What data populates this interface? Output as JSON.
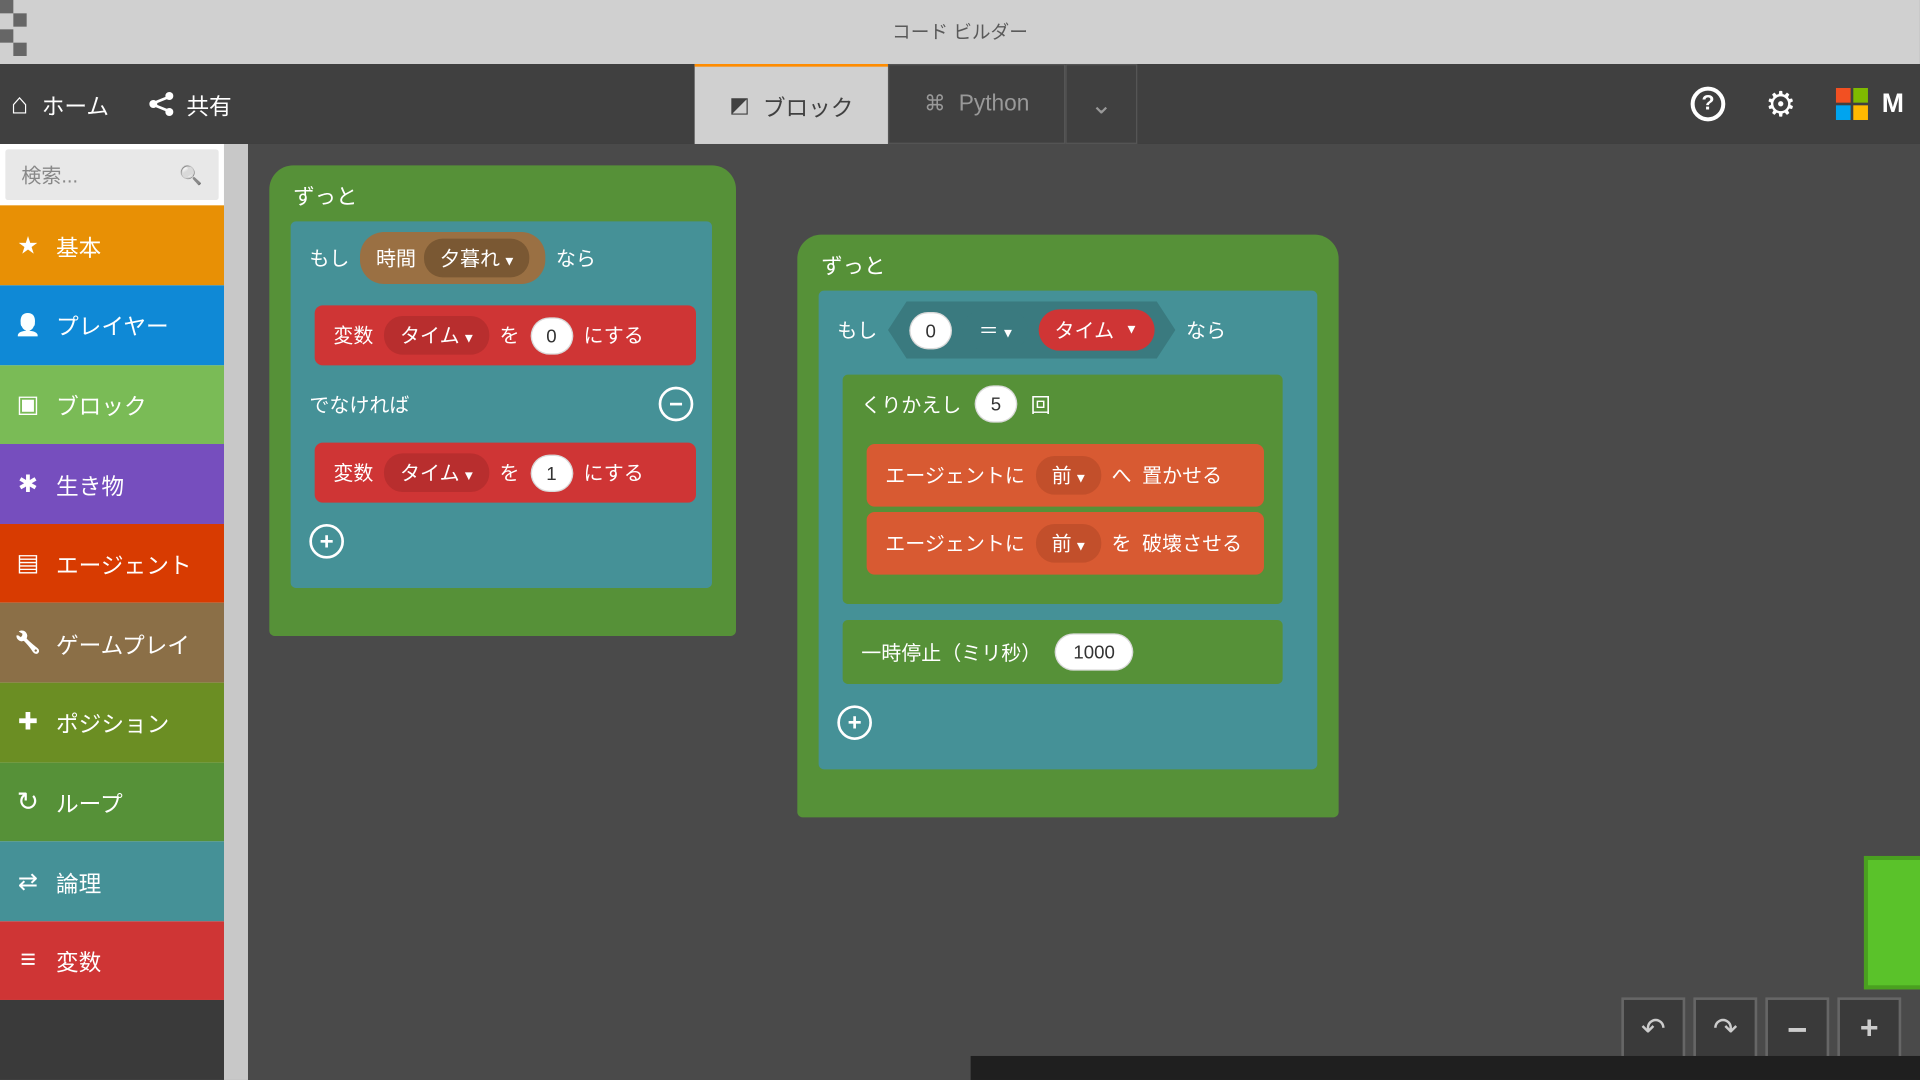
{
  "window": {
    "title": "コード ビルダー"
  },
  "toolbar": {
    "home": "ホーム",
    "share": "共有",
    "tab_blocks": "ブロック",
    "tab_python": "Python",
    "brand_initial": "M"
  },
  "search": {
    "placeholder": "検索..."
  },
  "categories": {
    "basic": "基本",
    "player": "プレイヤー",
    "block": "ブロック",
    "mob": "生き物",
    "agent": "エージェント",
    "gameplay": "ゲームプレイ",
    "position": "ポジション",
    "loops": "ループ",
    "logic": "論理",
    "variables": "変数"
  },
  "labels": {
    "forever": "ずっと",
    "if": "もし",
    "then": "なら",
    "else": "でなければ",
    "time_word": "時間",
    "dusk": "夕暮れ",
    "set_var": "変数",
    "var_time": "タイム",
    "to_word": "を",
    "ni_suru": "にする",
    "equals": "＝",
    "repeat": "くりかえし",
    "times": "回",
    "agent_ni": "エージェントに",
    "forward": "前",
    "he_word": "へ",
    "place": "置かせる",
    "wo_word": "を",
    "destroy": "破壊させる",
    "pause": "一時停止（ミリ秒）"
  },
  "values": {
    "zero": "0",
    "one": "1",
    "five": "5",
    "thousand": "1000"
  }
}
